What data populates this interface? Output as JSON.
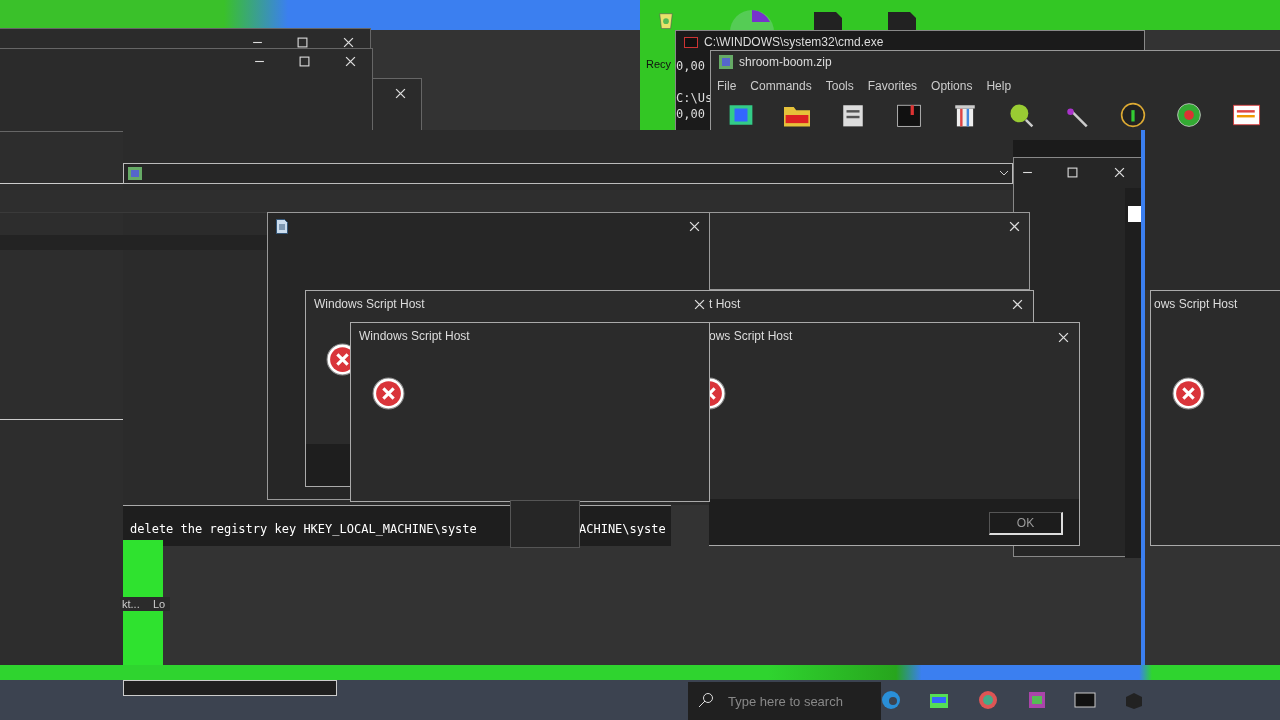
{
  "desktop_icons": [
    {
      "label": "Recy"
    }
  ],
  "cmd_window": {
    "title": "C:\\WINDOWS\\system32\\cmd.exe",
    "lines": [
      "0,00",
      "C:\\Us",
      "0,00"
    ]
  },
  "archive_window": {
    "title": "shroom-boom.zip",
    "menu": [
      "File",
      "Commands",
      "Tools",
      "Favorites",
      "Options",
      "Help"
    ]
  },
  "dialogs": [
    {
      "title": "Windows Script Host"
    },
    {
      "title": "t Host"
    },
    {
      "title": "ows Script Host"
    },
    {
      "title": "Windows Script Host"
    },
    {
      "title": "ows Script Host",
      "button": "OK"
    }
  ],
  "console": {
    "lines": [
      "delete the registry key HKEY_LOCAL_MACHINE\\syste",
      "ACHINE\\syste"
    ]
  },
  "background_window": {
    "labels": [
      "kt...",
      "Lo"
    ]
  },
  "taskbar": {
    "search": {
      "placeholder": "Type here to search"
    }
  }
}
